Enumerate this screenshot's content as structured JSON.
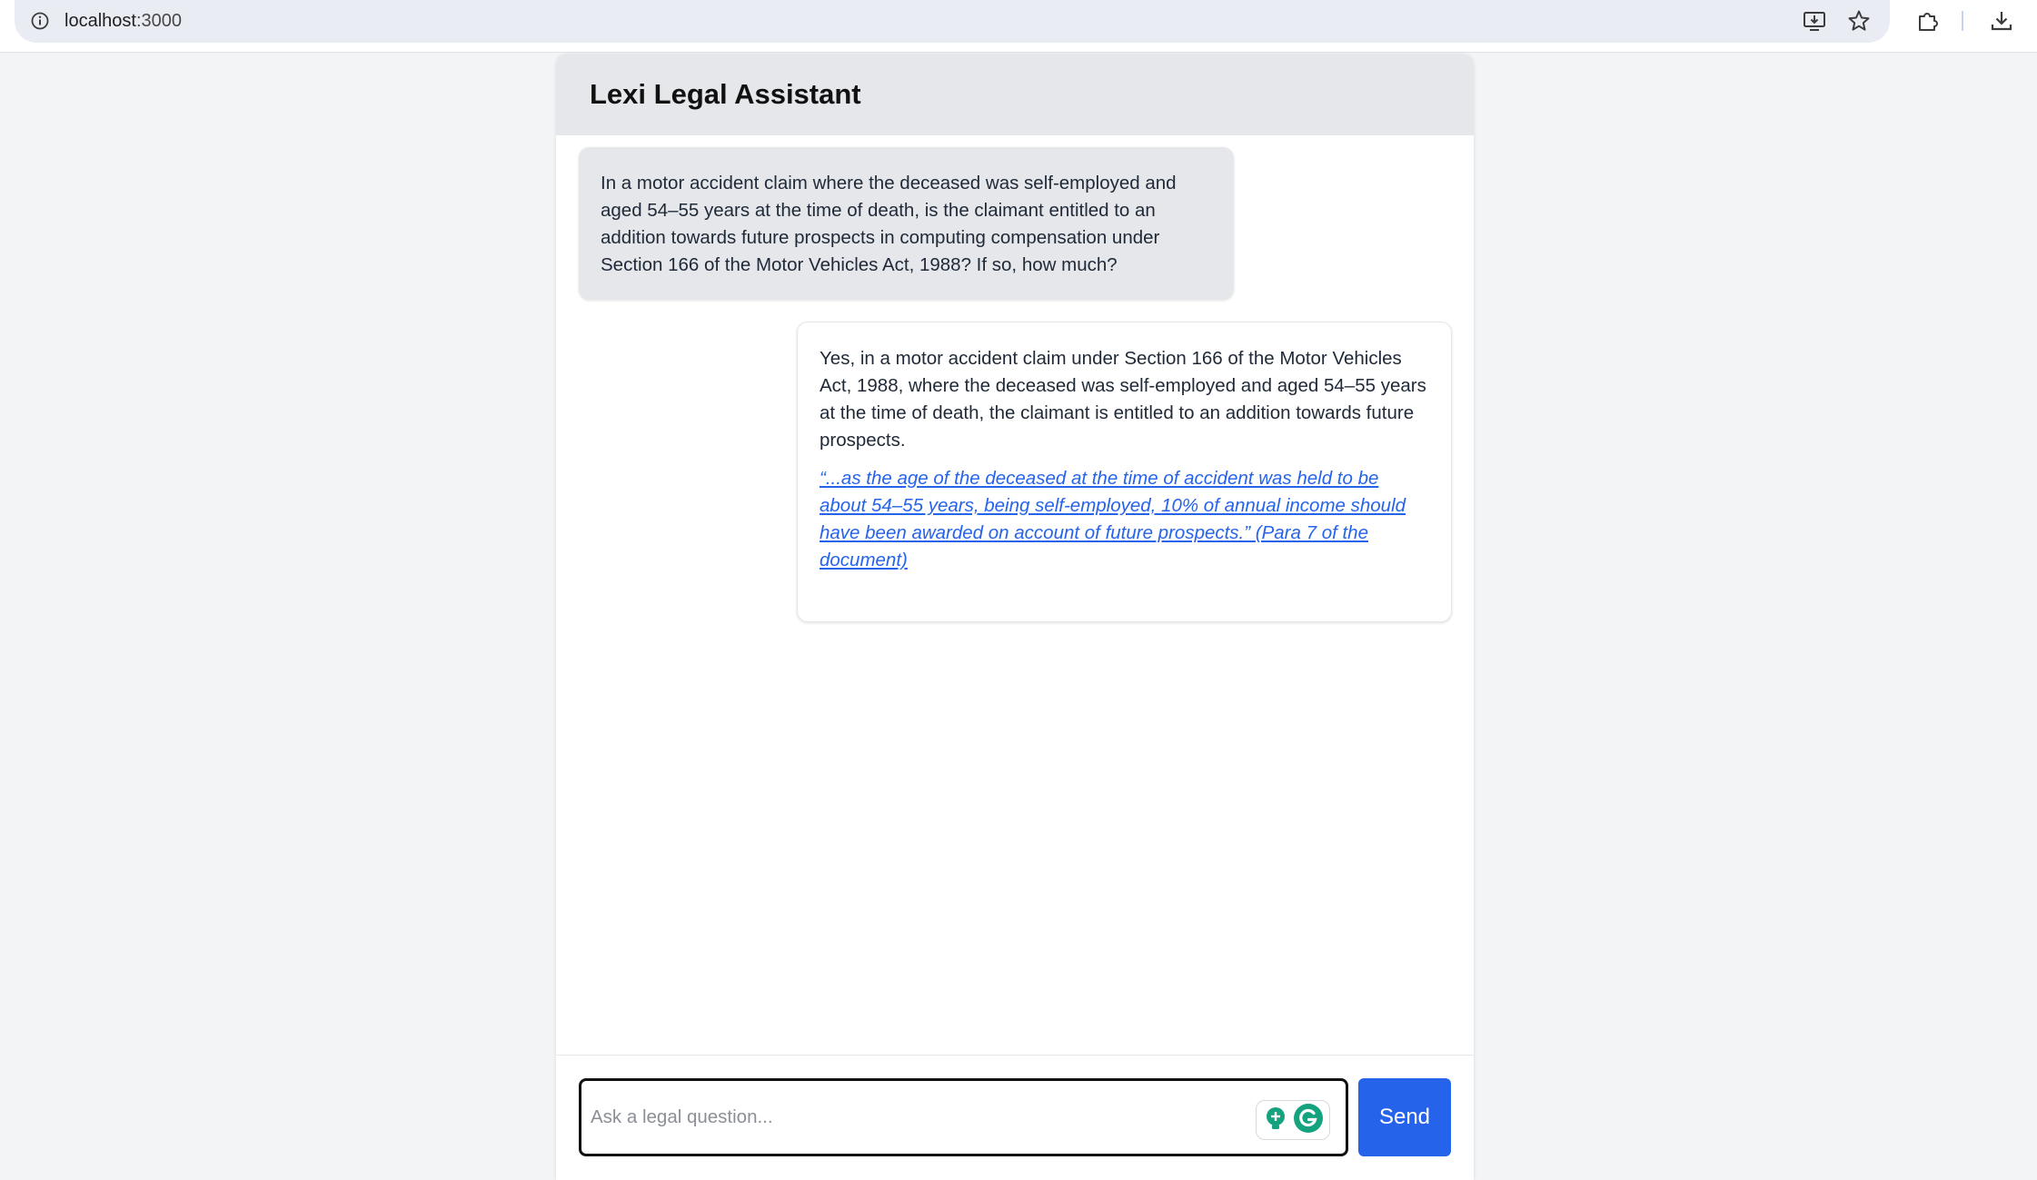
{
  "browser": {
    "url_host": "localhost",
    "url_port": ":3000",
    "icons": [
      "info-icon",
      "install-app-icon",
      "bookmark-star-icon",
      "extensions-puzzle-icon",
      "download-icon"
    ]
  },
  "app": {
    "title": "Lexi Legal Assistant"
  },
  "messages": [
    {
      "role": "user",
      "text": "In a motor accident claim where the deceased was self-employed and aged 54–55 years at the time of death, is the claimant entitled to an addition towards future prospects in computing compensation under Section 166 of the Motor Vehicles Act, 1988? If so, how much?"
    },
    {
      "role": "assistant",
      "text": "Yes, in a motor accident claim under Section 166 of the Motor Vehicles Act, 1988, where the deceased was self-employed and aged 54–55 years at the time of death, the claimant is entitled to an addition towards future prospects.",
      "citation": "“...as the age of the deceased at the time of accident was held to be about 54–55 years, being self-employed, 10% of annual income should have been awarded on account of future prospects.” (Para 7 of the document)"
    }
  ],
  "composer": {
    "placeholder": "Ask a legal question...",
    "value": "",
    "send_label": "Send"
  },
  "colors": {
    "accent": "#2563eb",
    "header_bg": "#e5e7eb",
    "page_bg": "#f3f4f6",
    "grammarly_green": "#15a37f"
  }
}
